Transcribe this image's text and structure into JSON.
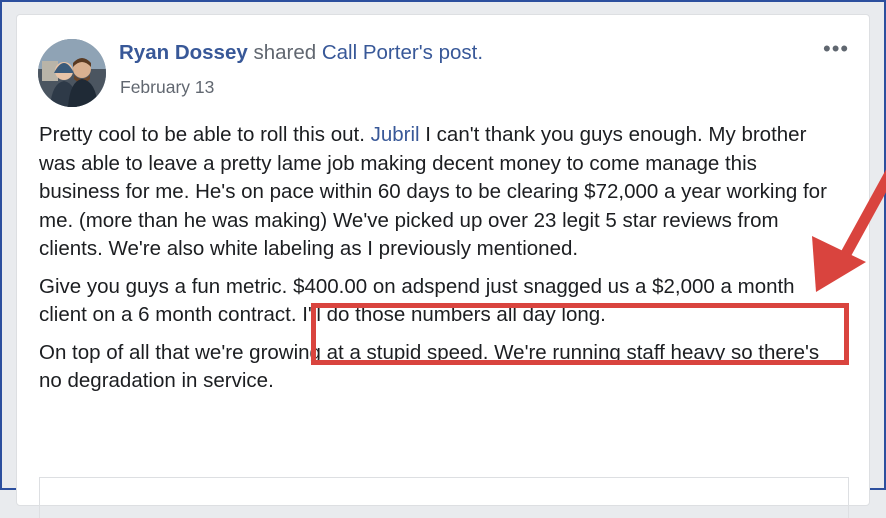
{
  "post": {
    "author": "Ryan Dossey",
    "shared_text": " shared ",
    "page_name": "Call Porter",
    "possessive": "'s",
    "post_link": "post",
    "period": ".",
    "date": "February 13",
    "more_icon": "•••"
  },
  "content": {
    "p1_start": "Pretty cool to be able to roll this out. ",
    "mention": "Jubril",
    "p1_rest": " I can't thank you guys enough. My brother was able to leave a pretty lame job making decent money to come manage this business for me. He's on pace within 60 days to be clearing $72,000 a year working for me. (more than he was making) We've picked up over 23 legit 5 star reviews from clients. We're also white labeling as I previously mentioned.",
    "p2": "Give you guys a fun metric. $400.00 on adspend just snagged us a $2,000 a month client on a 6 month contract. I'll do those numbers all day long.",
    "p3": "On top of all that we're growing at a stupid speed. We're running staff heavy so there's no degradation in service."
  },
  "colors": {
    "link": "#385898",
    "highlight": "#d9443e",
    "frame": "#2c4f9e"
  },
  "icons": {
    "more": "ellipsis-icon",
    "annotation": "red-arrow-icon"
  }
}
